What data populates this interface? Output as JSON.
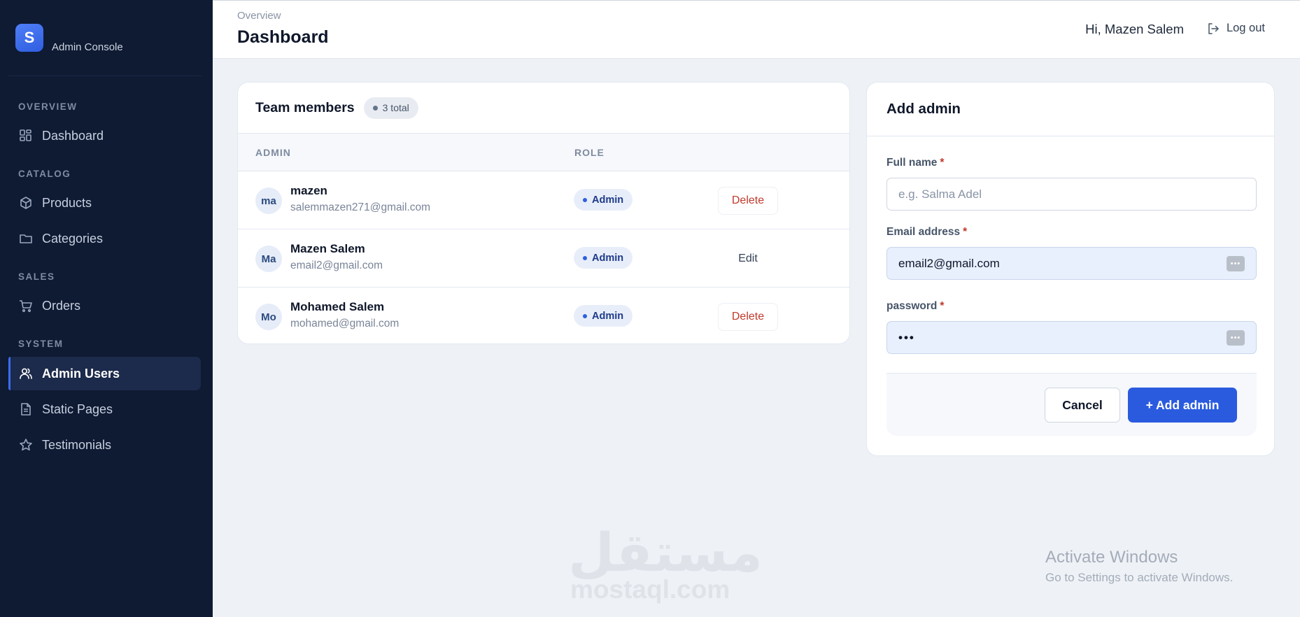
{
  "sidebar": {
    "brand_letter": "S",
    "brand_subtitle": "Admin Console",
    "sections": {
      "overview": "OVERVIEW",
      "catalog": "CATALOG",
      "sales": "SALES",
      "system": "SYSTEM"
    },
    "items": {
      "dashboard": "Dashboard",
      "products": "Products",
      "categories": "Categories",
      "orders": "Orders",
      "admin_users": "Admin Users",
      "static_pages": "Static Pages",
      "testimonials": "Testimonials"
    },
    "active_item": "admin_users",
    "accent_color": "#3b6cf0"
  },
  "header": {
    "breadcrumb": "Overview",
    "title": "Dashboard",
    "greeting": "Hi, Mazen Salem",
    "logout_label": "Log out"
  },
  "team": {
    "title": "Team members",
    "total_badge": "3 total",
    "columns": {
      "admin": "ADMIN",
      "role": "ROLE"
    },
    "rows": [
      {
        "initials": "ma",
        "name": "mazen",
        "email": "salemmazen271@gmail.com",
        "role": "Admin",
        "action": "Delete"
      },
      {
        "initials": "Ma",
        "name": "Mazen Salem",
        "email": "email2@gmail.com",
        "role": "Admin",
        "action": "Edit"
      },
      {
        "initials": "Mo",
        "name": "Mohamed Salem",
        "email": "mohamed@gmail.com",
        "role": "Admin",
        "action": "Delete"
      }
    ]
  },
  "add_admin": {
    "title": "Add admin",
    "full_name": {
      "label": "Full name",
      "required": "*",
      "placeholder": "e.g. Salma Adel",
      "value": ""
    },
    "email": {
      "label": "Email address",
      "required": "*",
      "value": "email2@gmail.com"
    },
    "password": {
      "label": "password",
      "required": "*",
      "value": "•••"
    },
    "cancel_label": "Cancel",
    "submit_label": "+ Add admin",
    "primary_color": "#2a5bdf",
    "danger_color": "#c0392b"
  },
  "watermark": {
    "arabic": "مستقل",
    "latin": "mostaql.com",
    "activate_title": "Activate Windows",
    "activate_sub": "Go to Settings to activate Windows."
  }
}
